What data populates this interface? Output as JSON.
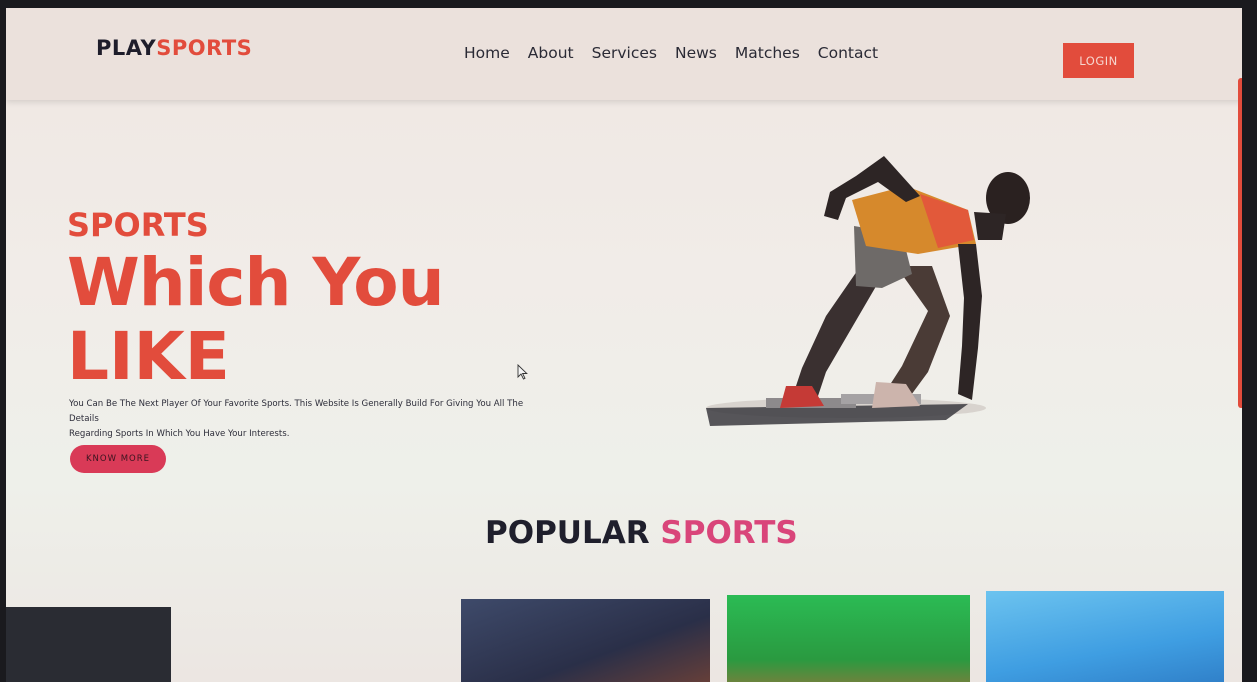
{
  "logo": {
    "part1": "PLAY",
    "part2": "SPORTS"
  },
  "nav": {
    "items": [
      "Home",
      "About",
      "Services",
      "News",
      "Matches",
      "Contact"
    ],
    "login_label": "LOGIN"
  },
  "hero": {
    "kicker": "SPORTS",
    "headline_line1": "Which You",
    "headline_line2": "LIKE",
    "description_line1": "You Can Be The Next Player Of Your Favorite Sports. This Website Is Generally Build For Giving You All The Details",
    "description_line2": "Regarding Sports In Which You Have Your Interests.",
    "cta_label": "KNOW MORE"
  },
  "popular": {
    "title_part1": "POPULAR",
    "title_part2": "SPORTS"
  },
  "colors": {
    "accent": "#e24c3c",
    "pink": "#d9457a",
    "dark": "#1e1d2b"
  }
}
